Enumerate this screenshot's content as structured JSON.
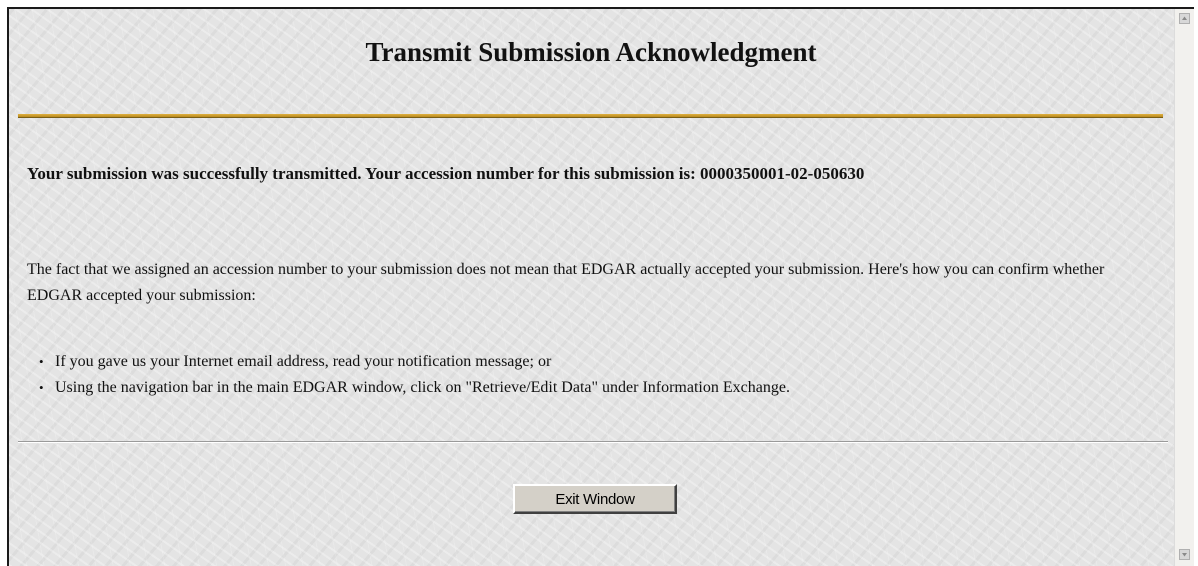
{
  "window": {
    "title": "Transmit Submission Acknowledgment"
  },
  "message": {
    "success": "Your submission was successfully transmitted. Your accession number for this submission is: 0000350001-02-050630",
    "info": "The fact that we assigned an accession number to your submission does not mean that EDGAR actually accepted your submission. Here's how you can confirm whether EDGAR accepted your submission:",
    "steps": [
      "If you gave us your Internet email address, read your notification message; or",
      "Using the navigation bar in the main EDGAR window, click on \"Retrieve/Edit Data\" under Information Exchange."
    ]
  },
  "actions": {
    "exit_label": "Exit Window"
  },
  "icons": {
    "bullet": "•",
    "scroll_up": "scroll-up-arrow-icon",
    "scroll_down": "scroll-down-arrow-icon"
  },
  "colors": {
    "title_rule": "#d9a52c",
    "background": "#e4e4e4",
    "button_face": "#d4d0c8"
  }
}
